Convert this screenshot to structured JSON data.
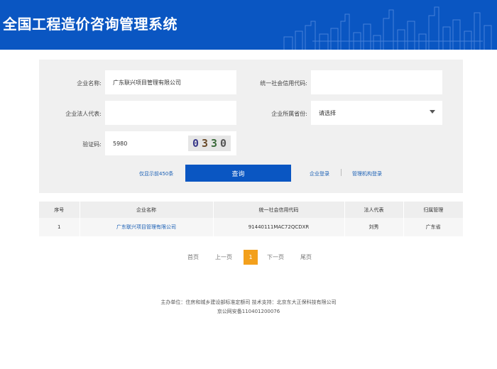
{
  "header": {
    "title": "全国工程造价咨询管理系统"
  },
  "form": {
    "company_name": {
      "label": "企业名称:",
      "value": "广东联兴项目管理有限公司"
    },
    "credit_code": {
      "label": "统一社会信用代码:",
      "value": ""
    },
    "legal_rep": {
      "label": "企业法人代表:",
      "value": ""
    },
    "province": {
      "label": "企业所属省份:",
      "value": "请选择"
    },
    "captcha": {
      "label": "验证码:",
      "value": "5980",
      "image_digits": [
        "0",
        "3",
        "3",
        "0"
      ]
    },
    "show_count_link": "仅显示前450条",
    "query_button": "查询",
    "company_login": "企业登录",
    "agency_login": "管理机构登录"
  },
  "results": {
    "columns": [
      "序号",
      "企业名称",
      "统一社会信用代码",
      "法人代表",
      "归属管理"
    ],
    "rows": [
      {
        "index": "1",
        "company": "广东联兴项目管理有限公司",
        "credit_code": "91440111MAC72QCDXR",
        "legal_rep": "刘秀",
        "province": "广东省"
      }
    ]
  },
  "pagination": {
    "first": "首页",
    "prev": "上一页",
    "current": "1",
    "next": "下一页",
    "last": "尾页"
  },
  "footer": {
    "line1": "主办单位：住房和城乡建设部标准定额司  技术支持：北京东大正保科技有限公司",
    "line2": "京公网安备110401200076"
  },
  "colors": {
    "brand_blue": "#0a56c2",
    "link_blue": "#1a5fb4",
    "current_page": "#f3a01c"
  }
}
